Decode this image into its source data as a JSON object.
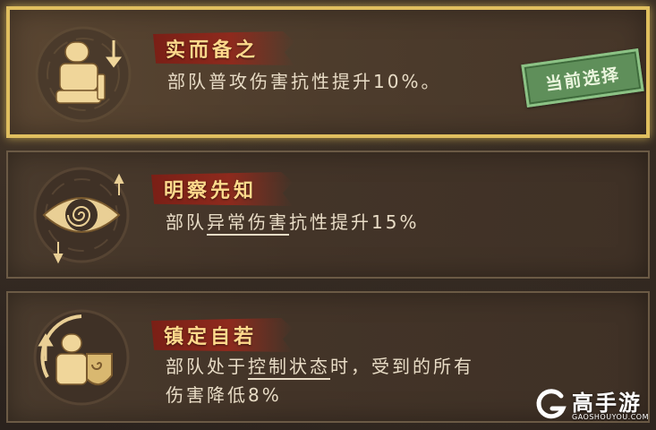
{
  "colors": {
    "selected_border": "#e0bf5f",
    "title_text": "#ffd98c",
    "ribbon": "#8e2a1d",
    "desc_text": "#e8dcc6",
    "stamp_green": "#5f8f5a"
  },
  "skills": [
    {
      "title": "实而备之",
      "desc": "部队普攻伤害抗性提升10%。",
      "icon": "armored-soldier-arrow-icon",
      "selected": true,
      "badge": "当前选择"
    },
    {
      "title": "明察先知",
      "desc_prefix": "部队",
      "desc_underlined": "异常伤害",
      "desc_suffix": "抗性提升15%",
      "icon": "spiral-eye-icon",
      "selected": false
    },
    {
      "title": "镇定自若",
      "desc_prefix": "部队处于",
      "desc_underlined": "控制状态",
      "desc_suffix": "时，受到的所有伤害降低8%",
      "icon": "shield-soldier-icon",
      "selected": false
    }
  ],
  "watermark": {
    "name": "高手游",
    "domain": "GAOSHOUYOU.COM",
    "icon": "g-logo-icon"
  }
}
